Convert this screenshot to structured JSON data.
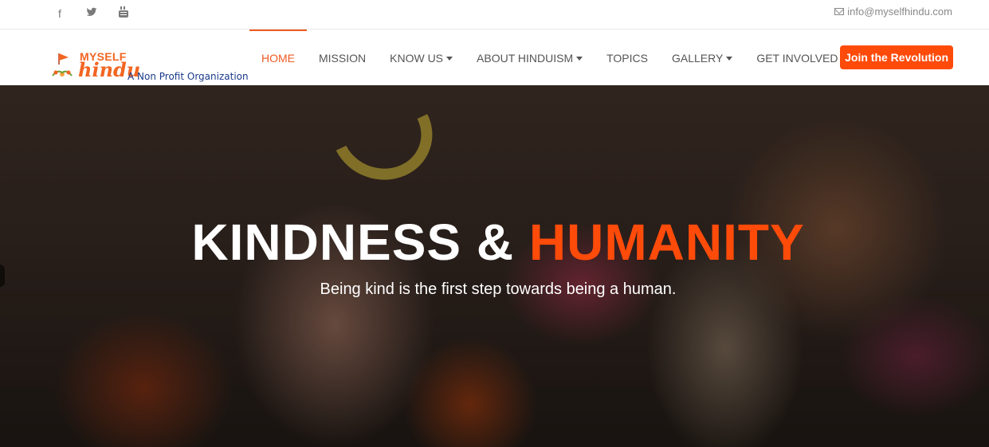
{
  "topbar": {
    "social": [
      {
        "icon": "facebook-icon",
        "glyph": "f"
      },
      {
        "icon": "twitter-icon",
        "glyph": "🐦"
      },
      {
        "icon": "youtube-icon",
        "glyph": "▶"
      }
    ],
    "email": "info@myselfhindu.com"
  },
  "logo": {
    "line1": "MYSELF",
    "line2": "hindu",
    "tagline": "A Non Profit Organization"
  },
  "nav": {
    "items": [
      {
        "label": "HOME",
        "active": true,
        "dropdown": false
      },
      {
        "label": "MISSION",
        "active": false,
        "dropdown": false
      },
      {
        "label": "KNOW US",
        "active": false,
        "dropdown": true
      },
      {
        "label": "ABOUT HINDUISM",
        "active": false,
        "dropdown": true
      },
      {
        "label": "TOPICS",
        "active": false,
        "dropdown": false
      },
      {
        "label": "GALLERY",
        "active": false,
        "dropdown": true
      },
      {
        "label": "GET INVOLVED",
        "active": false,
        "dropdown": true
      }
    ],
    "cta": "Join the Revolution"
  },
  "hero": {
    "title_part1": "KINDNESS & ",
    "title_part2": "HUMANITY",
    "subtitle": "Being kind is the first step towards being a human."
  },
  "colors": {
    "accent": "#ff4b0a",
    "nav_text": "#555555",
    "tagline": "#1a3a8a"
  }
}
